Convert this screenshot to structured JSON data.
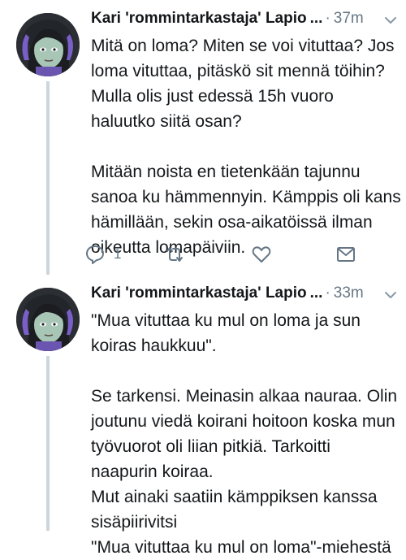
{
  "tweets": [
    {
      "author_name": "Kari 'rommintarkastaja' Lapio",
      "ellipsis": "...",
      "separator": "·",
      "time": "37m",
      "text": "Mitä on loma? Miten se voi vituttaa? Jos\nloma vituttaa, pitäskö sit mennä töihin?\nMulla olis just edessä 15h vuoro\nhaluutko siitä osan?\n\nMitään noista en tietenkään tajunnu\nsanoa ku hämmennyin. Kämppis oli kans\nhämillään, sekin osa-aikatöissä ilman\noikeutta lomapäiviin.",
      "reply_count": "1"
    },
    {
      "author_name": "Kari 'rommintarkastaja' Lapio",
      "ellipsis": "...",
      "separator": "·",
      "time": "33m",
      "text": "\"Mua vituttaa ku mul on loma ja sun\nkoiras haukkuu\".\n\nSe tarkensi. Meinasin alkaa nauraa. Olin\njoutunu viedä koirani hoitoon koska mun\ntyövuorot oli liian pitkiä. Tarkoitti\nnaapurin koiraa.\nMut ainaki saatiin kämppiksen kanssa\nsisäpiirivitsi\n\"Mua vituttaa ku mul on loma\"-miehestä"
    }
  ],
  "icons": {
    "reply": "reply-icon",
    "retweet": "retweet-icon",
    "like": "heart-icon",
    "dm": "envelope-icon",
    "caret": "chevron-down-icon"
  },
  "colors": {
    "text": "#14171a",
    "secondary": "#657786",
    "thread_line": "#ccd6dd"
  }
}
